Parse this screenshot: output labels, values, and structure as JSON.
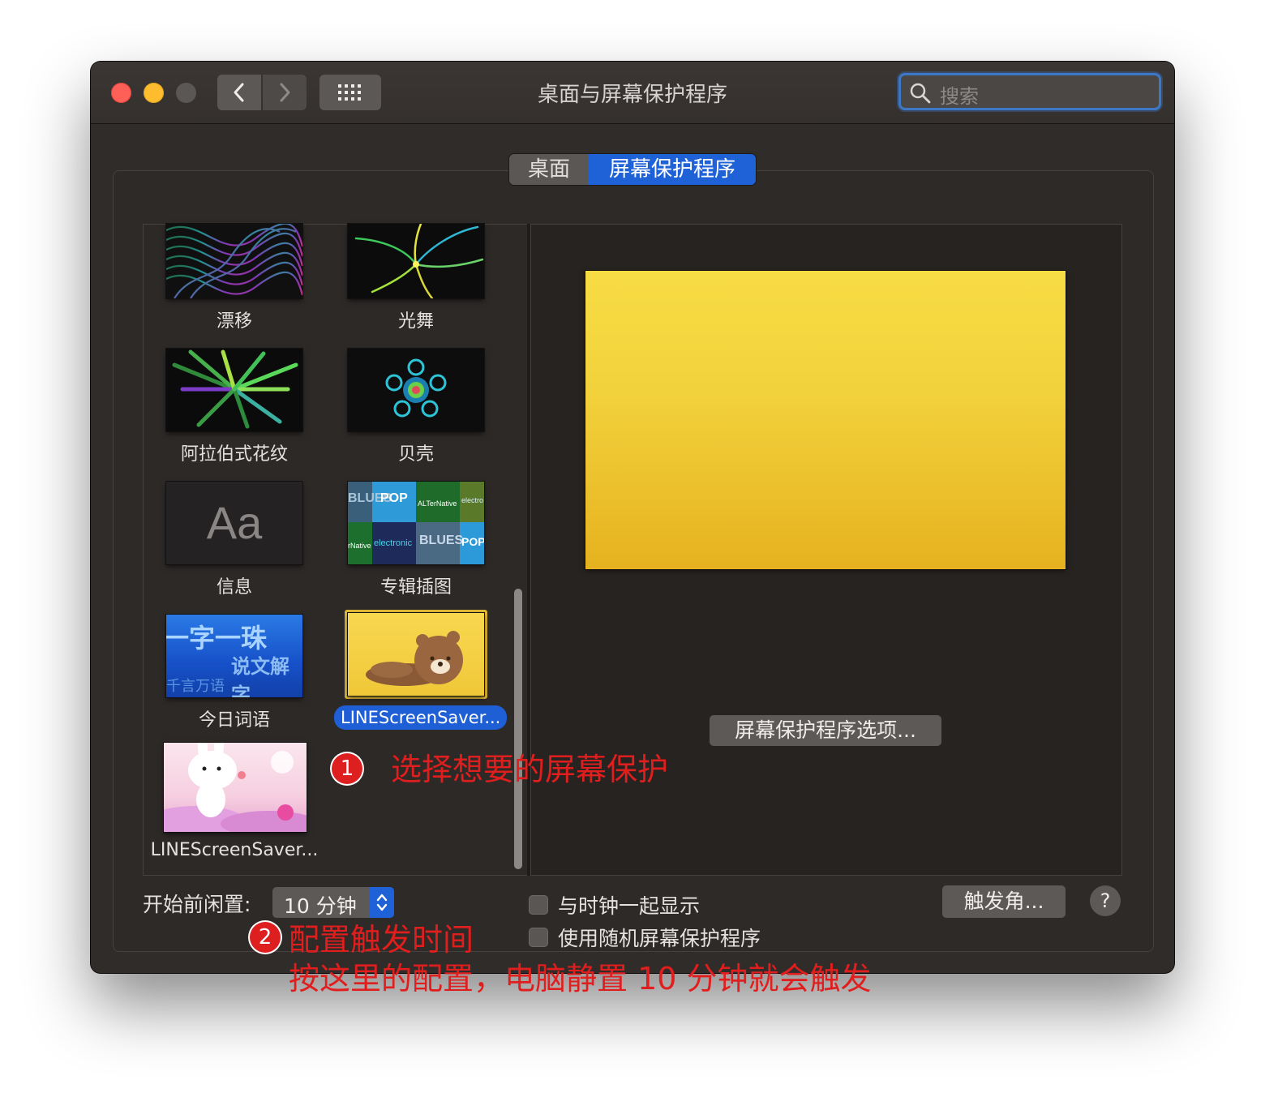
{
  "window": {
    "title": "桌面与屏幕保护程序",
    "search": {
      "placeholder": "搜索"
    }
  },
  "icons": {
    "nav_back": "chevron-left-icon",
    "nav_forward": "chevron-right-icon",
    "grid": "grid-icon",
    "search": "search-icon",
    "stepper": "up-down-chevron-icon"
  },
  "tabs": [
    {
      "label": "桌面",
      "selected": false
    },
    {
      "label": "屏幕保护程序",
      "selected": true
    }
  ],
  "screensavers": [
    {
      "label": "漂移",
      "selected": false
    },
    {
      "label": "光舞",
      "selected": false
    },
    {
      "label": "阿拉伯式花纹",
      "selected": false
    },
    {
      "label": "贝壳",
      "selected": false
    },
    {
      "label": "信息",
      "selected": false,
      "thumb_text": "Aa"
    },
    {
      "label": "专辑插图",
      "selected": false,
      "thumb_words": [
        "BLUES",
        "POP",
        "ALTerNative",
        "electro",
        "electronic",
        "BLUES",
        "POP",
        "rNative"
      ]
    },
    {
      "label": "今日词语",
      "selected": false,
      "thumb_words": [
        "一字一珠",
        "说文解字",
        "千言万语"
      ]
    },
    {
      "label": "LINEScreenSaver...",
      "selected": true
    },
    {
      "label": "LINEScreenSaver...",
      "selected": false
    }
  ],
  "preview": {
    "options_button": "屏幕保护程序选项..."
  },
  "footer": {
    "idle_label": "开始前闲置:",
    "idle_value": "10 分钟",
    "show_clock_label": "与时钟一起显示",
    "show_clock_checked": false,
    "random_label": "使用随机屏幕保护程序",
    "random_checked": false,
    "hot_corners": "触发角...",
    "help": "?"
  },
  "annotations": {
    "step1_num": "1",
    "step1_text": "选择想要的屏幕保护",
    "step2_num": "2",
    "step2_text": "配置触发时间",
    "step2_detail": "按这里的配置，电脑静置 10 分钟就会触发"
  },
  "colors": {
    "accent": "#1f62d8",
    "annotation": "#e01e1e",
    "close": "#fe5f57",
    "minimize": "#febc2e",
    "preview_yellow": "#f2d23c"
  }
}
